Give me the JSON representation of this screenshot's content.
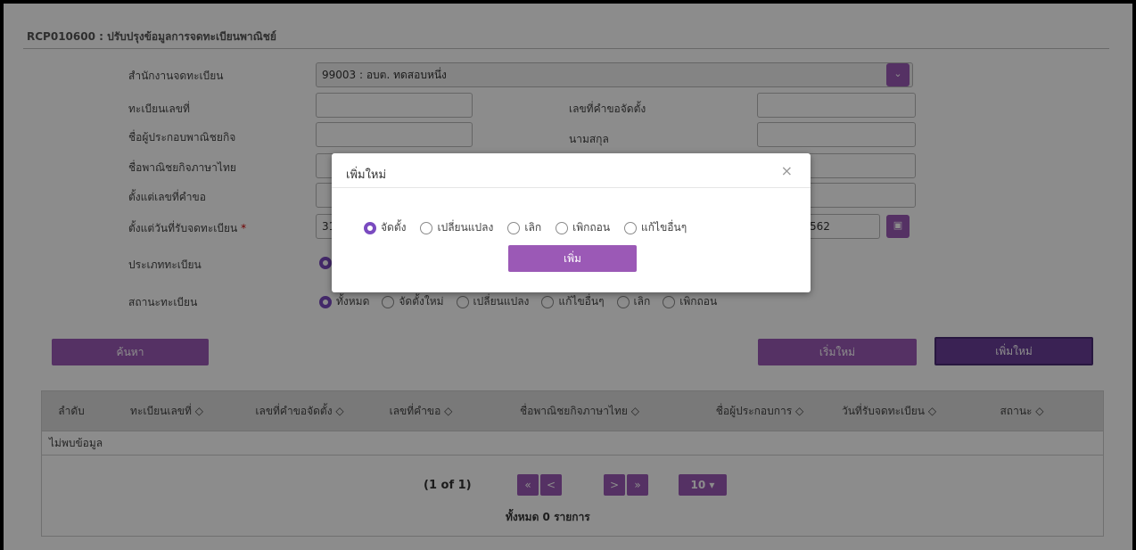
{
  "header": {
    "title": "RCP010600 : ปรับปรุงข้อมูลการจดทะเบียนพาณิชย์"
  },
  "form": {
    "office_label": "สำนักงานจดทะเบียน",
    "office_value": "99003 : อบต. ทดสอบหนึ่ง",
    "reg_no_label": "ทะเบียนเลขที่",
    "request_no_label": "เลขที่คำขอจัดตั้ง",
    "first_name_label": "ชื่อผู้ประกอบพาณิชยกิจ",
    "last_name_label": "นามสกุล",
    "business_name_label": "ชื่อพาณิชยกิจภาษาไทย",
    "from_request_label": "ตั้งแต่เลขที่คำขอ",
    "from_date_label": "ตั้งแต่วันที่รับจดทะเบียน",
    "required_mark": "*",
    "from_date_value": "31",
    "to_date_value": "562",
    "reg_type_label": "ประเภททะเบียน",
    "status_label": "สถานะทะเบียน",
    "status_options": [
      "ทั้งหมด",
      "จัดตั้งใหม่",
      "เปลี่ยนแปลง",
      "แก้ไขอื่นๆ",
      "เลิก",
      "เพิกถอน"
    ]
  },
  "buttons": {
    "search": "ค้นหา",
    "reset": "เริ่มใหม่",
    "add_new": "เพิ่มใหม่"
  },
  "table": {
    "columns": [
      "ลำดับ",
      "ทะเบียนเลขที่ ◇",
      "เลขที่คำขอจัดตั้ง ◇",
      "เลขที่คำขอ ◇",
      "ชื่อพาณิชยกิจภาษาไทย ◇",
      "ชื่อผู้ประกอบการ ◇",
      "วันที่รับจดทะเบียน ◇",
      "สถานะ ◇"
    ],
    "empty_text": "ไม่พบข้อมูล"
  },
  "pager": {
    "page_info": "(1 of 1)",
    "first": "«",
    "prev": "<",
    "next": ">",
    "last": "»",
    "page_size": "10 ▾",
    "total": "ทั้งหมด 0 รายการ"
  },
  "modal": {
    "title": "เพิ่มใหม่",
    "close": "×",
    "options": [
      "จัดตั้ง",
      "เปลี่ยนแปลง",
      "เลิก",
      "เพิกถอน",
      "แก้ไขอื่นๆ"
    ],
    "submit": "เพิ่ม"
  },
  "colors": {
    "accent": "#9b59b6",
    "accent_dark": "#6b3e9a"
  }
}
